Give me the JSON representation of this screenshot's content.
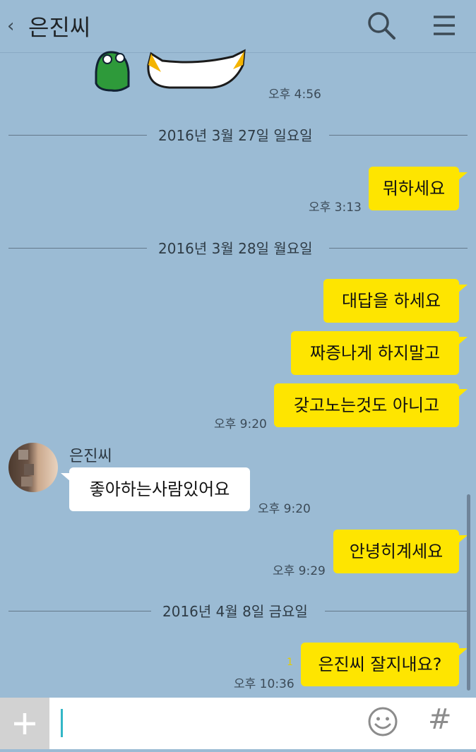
{
  "header": {
    "back_icon": "chevron-left-icon",
    "title": "은진씨",
    "search_icon": "search-icon",
    "menu_icon": "menu-icon"
  },
  "messages": [
    {
      "type": "sticker",
      "time": "오후 4:56"
    },
    {
      "type": "date",
      "label": "2016년 3월 27일 일요일"
    },
    {
      "type": "mine",
      "text": "뭐하세요",
      "time": "오후 3:13"
    },
    {
      "type": "date",
      "label": "2016년 3월 28일 월요일"
    },
    {
      "type": "mine",
      "text": "대답을 하세요"
    },
    {
      "type": "mine",
      "text": "짜증나게 하지말고"
    },
    {
      "type": "mine",
      "text": "갖고노는것도 아니고",
      "time": "오후 9:20"
    },
    {
      "type": "other",
      "sender": "은진씨",
      "text": "좋아하는사람있어요",
      "time": "오후 9:20"
    },
    {
      "type": "mine",
      "text": "안녕히계세요",
      "time": "오후 9:29"
    },
    {
      "type": "date",
      "label": "2016년 4월 8일 금요일"
    },
    {
      "type": "mine",
      "text": "은진씨 잘지내요?",
      "time": "오후 10:36",
      "unread": "1"
    }
  ],
  "input": {
    "plus_label": "+",
    "hash_label": "#",
    "emoji_icon": "smiley-icon"
  },
  "colors": {
    "background": "#9bbbd4",
    "my_bubble": "#fee500",
    "other_bubble": "#ffffff"
  }
}
